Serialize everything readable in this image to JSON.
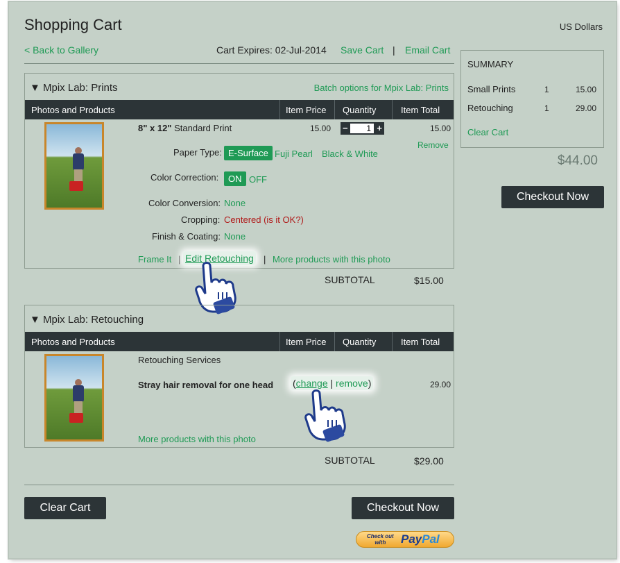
{
  "header": {
    "title": "Shopping Cart",
    "currency": "US Dollars",
    "back_link": "< Back to Gallery",
    "cart_expires": "Cart Expires: 02-Jul-2014",
    "save_cart": "Save Cart",
    "separator": "|",
    "email_cart": "Email Cart"
  },
  "table_headers": {
    "photos": "Photos and Products",
    "price": "Item Price",
    "quantity": "Quantity",
    "total": "Item Total"
  },
  "prints": {
    "title": "Mpix Lab: Prints",
    "batch_link": "Batch options for Mpix Lab: Prints",
    "product_size": "8\" x 12\"",
    "product_name": "Standard Print",
    "price": "15.00",
    "quantity": "1",
    "item_total": "15.00",
    "remove": "Remove",
    "paper_type_label": "Paper Type:",
    "paper_options": [
      "E-Surface",
      "Fuji Pearl",
      "Black & White"
    ],
    "color_correction_label": "Color Correction:",
    "color_correction_on": "ON",
    "color_correction_off": "OFF",
    "color_conversion_label": "Color Conversion:",
    "color_conversion_value": "None",
    "cropping_label": "Cropping:",
    "cropping_value": "Centered (is it OK?)",
    "finish_label": "Finish & Coating:",
    "finish_value": "None",
    "frame_it": "Frame It",
    "edit_retouching": "Edit Retouching",
    "more_products": "More products with this photo",
    "subtotal_label": "SUBTOTAL",
    "subtotal_value": "$15.00"
  },
  "retouching": {
    "title": "Mpix Lab: Retouching",
    "service_title": "Retouching Services",
    "service_desc": "Stray hair removal for one head",
    "change": "change",
    "remove": "remove",
    "item_total": "29.00",
    "more_products": "More products with this photo",
    "subtotal_label": "SUBTOTAL",
    "subtotal_value": "$29.00"
  },
  "summary": {
    "title": "SUMMARY",
    "rows": [
      {
        "name": "Small Prints",
        "qty": "1",
        "amount": "15.00"
      },
      {
        "name": "Retouching",
        "qty": "1",
        "amount": "29.00"
      }
    ],
    "clear_cart": "Clear Cart",
    "total": "$44.00",
    "checkout": "Checkout Now"
  },
  "footer": {
    "clear_cart": "Clear Cart",
    "checkout": "Checkout Now",
    "paypal_checkout_top": "Check out",
    "paypal_checkout_bottom": "with",
    "paypal_brand_a": "Pay",
    "paypal_brand_b": "Pal"
  }
}
